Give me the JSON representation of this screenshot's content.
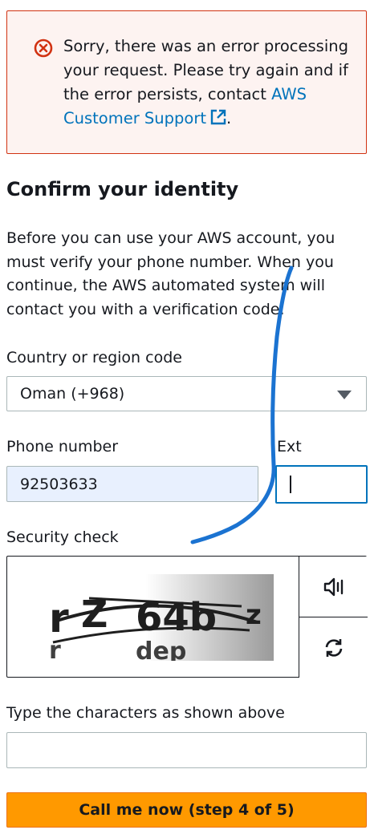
{
  "alert": {
    "text": "Sorry, there was an error processing your request. Please try again and if the error persists, contact ",
    "link_text": "AWS Customer Support",
    "suffix": "."
  },
  "page": {
    "title": "Confirm your identity",
    "description": "Before you can use your AWS account, you must verify your phone number. When you continue, the AWS automated system will contact you with a verification code."
  },
  "country": {
    "label": "Country or region code",
    "value": "Oman (+968)"
  },
  "phone": {
    "label": "Phone number",
    "value": "92503633",
    "ext_label": "Ext",
    "ext_value": ""
  },
  "captcha": {
    "label": "Security check",
    "chars_label": "Type the characters as shown above",
    "value": ""
  },
  "submit": {
    "label": "Call me now (step 4 of 5)"
  },
  "colors": {
    "error": "#d13212",
    "link": "#0073bb",
    "primary": "#ff9900",
    "autofill": "#e8f0fe"
  },
  "icons": [
    "error-circle-icon",
    "external-link-icon",
    "chevron-down-icon",
    "speaker-icon",
    "refresh-icon"
  ]
}
